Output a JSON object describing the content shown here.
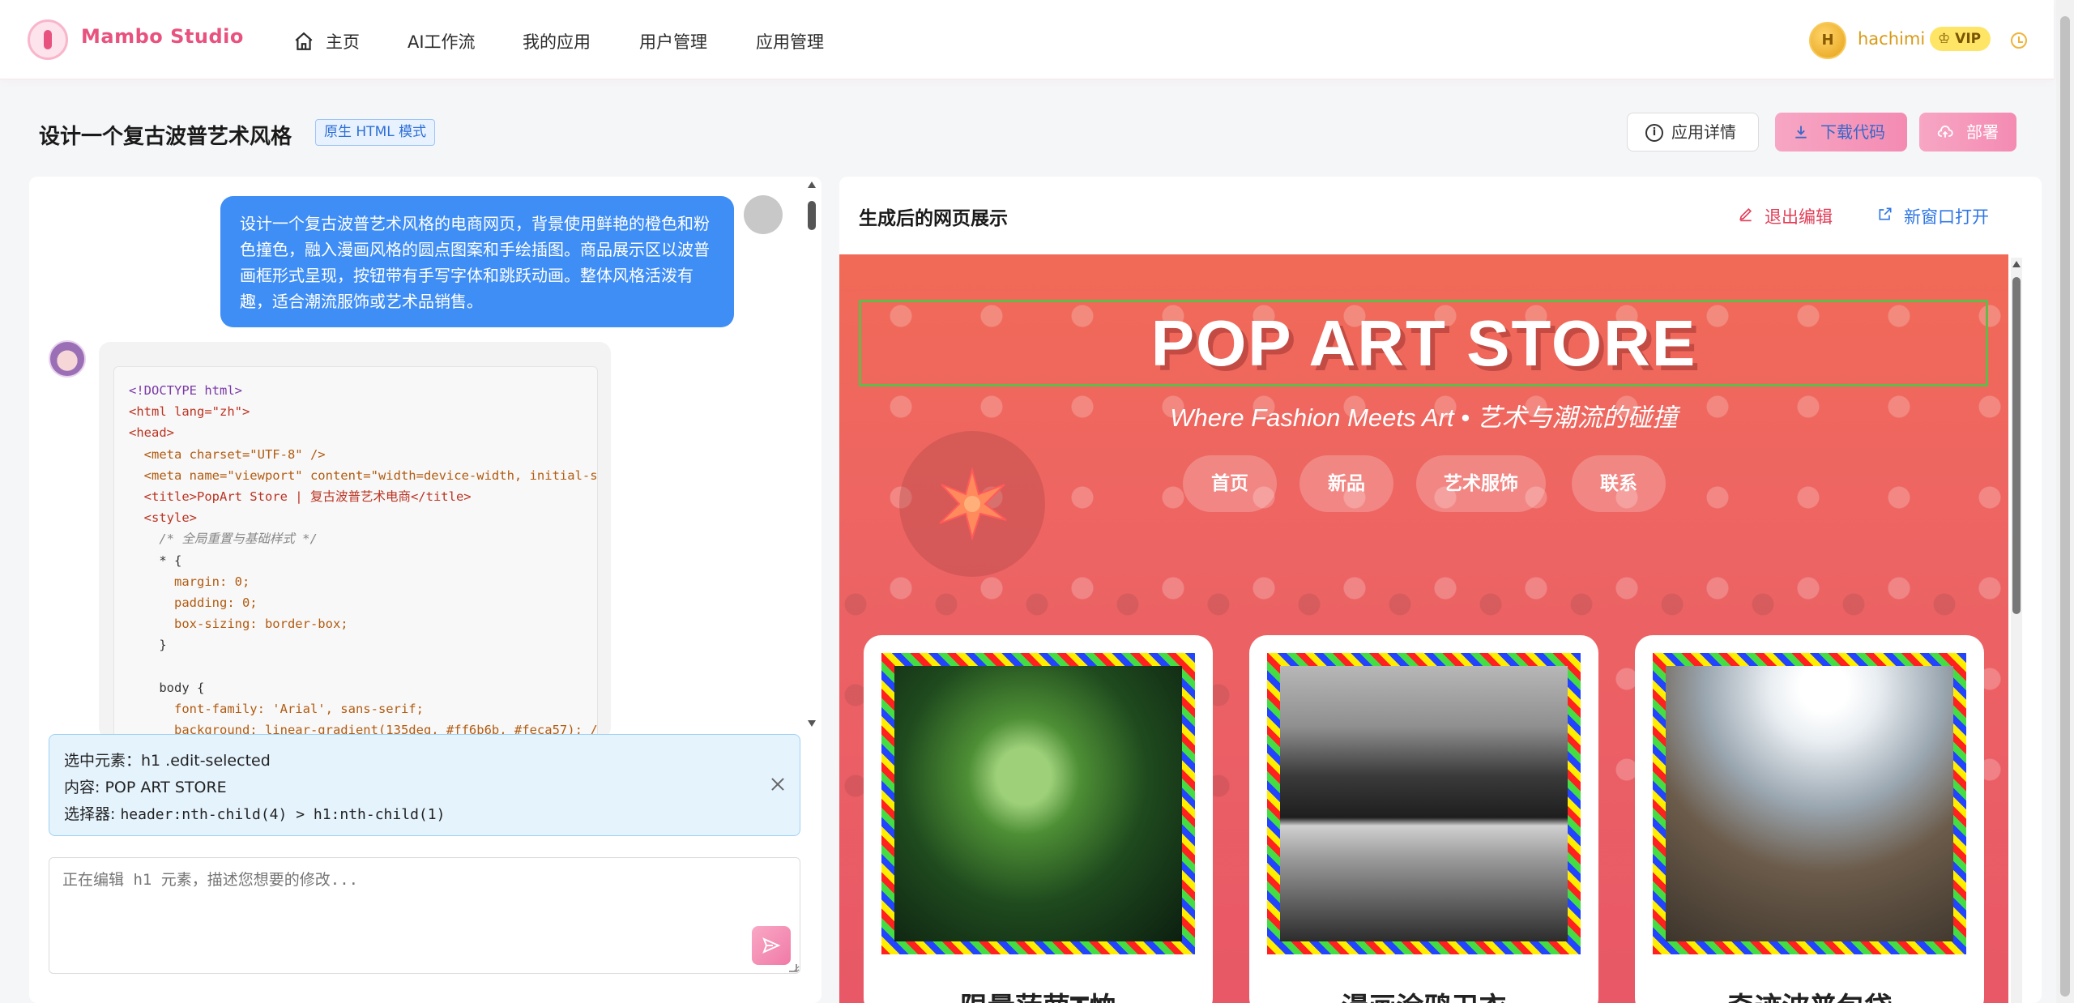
{
  "brand": {
    "name": "Mambo Studio"
  },
  "nav": {
    "items": [
      "主页",
      "AI工作流",
      "我的应用",
      "用户管理",
      "应用管理"
    ]
  },
  "user": {
    "name": "hachimi",
    "avatar_letter": "H",
    "vip": "VIP"
  },
  "page": {
    "title": "设计一个复古波普艺术风格",
    "mode": "原生 HTML 模式",
    "buttons": {
      "detail": "应用详情",
      "download": "下载代码",
      "deploy": "部署"
    }
  },
  "chat": {
    "user_message": "设计一个复古波普艺术风格的电商网页，背景使用鲜艳的橙色和粉色撞色，融入漫画风格的圆点图案和手绘插图。商品展示区以波普画框形式呈现，按钮带有手写字体和跳跃动画。整体风格活泼有趣，适合潮流服饰或艺术品销售。",
    "code_lines": [
      "<!DOCTYPE html>",
      "<html lang=\"zh\">",
      "<head>",
      "  <meta charset=\"UTF-8\" />",
      "  <meta name=\"viewport\" content=\"width=device-width, initial-sca",
      "  <title>PopArt Store | 复古波普艺术电商</title>",
      "  <style>",
      "    /* 全局重置与基础样式 */",
      "    * {",
      "      margin: 0;",
      "      padding: 0;",
      "      box-sizing: border-box;",
      "    }",
      "",
      "    body {",
      "      font-family: 'Arial', sans-serif;",
      "      background: linear-gradient(135deg, #ff6b6b, #feca57); /*"
    ]
  },
  "selection": {
    "element_label": "选中元素：",
    "element": "h1 .edit-selected",
    "content_label": "内容: ",
    "content": "POP ART STORE",
    "selector_label": "选择器: ",
    "selector": "header:nth-child(4) > h1:nth-child(1)"
  },
  "edit_input": {
    "placeholder": "正在编辑 h1 元素，描述您想要的修改..."
  },
  "preview": {
    "title": "生成后的网页展示",
    "exit_edit": "退出编辑",
    "open_new": "新窗口打开",
    "site": {
      "title": "POP ART STORE",
      "subtitle": "Where Fashion Meets Art • 艺术与潮流的碰撞",
      "nav": [
        "首页",
        "新品",
        "艺术服饰",
        "联系"
      ],
      "cards": [
        "限量菠萝T恤",
        "漫画涂鸦卫衣",
        "奇迹波普包袋"
      ]
    }
  },
  "colors": {
    "accent": "#e8527f",
    "primary_blue": "#3f8ef5",
    "pop_red": "#ed6464",
    "selection_green": "#65b84a"
  }
}
